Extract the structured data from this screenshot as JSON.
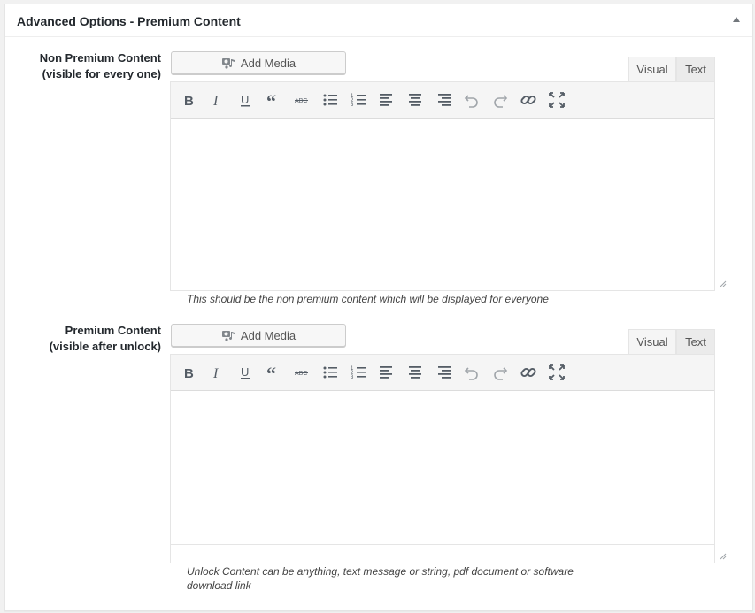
{
  "metabox": {
    "title": "Advanced Options - Premium Content"
  },
  "fields": [
    {
      "label_line1": "Non Premium Content",
      "label_line2": "(visible for every one)",
      "add_media_label": "Add Media",
      "tab_visual": "Visual",
      "tab_text": "Text",
      "description": "This should be the non premium content which will be displayed for everyone"
    },
    {
      "label_line1": "Premium Content",
      "label_line2": "(visible after unlock)",
      "add_media_label": "Add Media",
      "tab_visual": "Visual",
      "tab_text": "Text",
      "description_line1": "Unlock Content can be anything, text message or string, pdf document or software",
      "description_line2": "download link"
    }
  ],
  "toolbar_icons": [
    "bold-icon",
    "italic-icon",
    "underline-icon",
    "blockquote-icon",
    "strikethrough-icon",
    "bullet-list-icon",
    "numbered-list-icon",
    "align-left-icon",
    "align-center-icon",
    "align-right-icon",
    "undo-icon",
    "redo-icon",
    "link-icon",
    "fullscreen-icon"
  ],
  "colors": {
    "icon": "#555d66",
    "icon_disabled": "#a0a5aa",
    "border": "#e5e5e5"
  }
}
